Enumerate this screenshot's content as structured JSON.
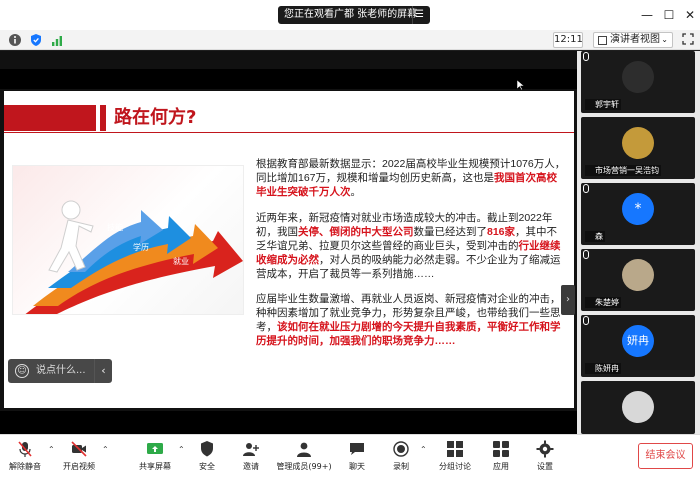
{
  "titlebar": {
    "share_notice": "您正在观看广都 张老师的屏幕",
    "minimize": "—",
    "maximize": "☐",
    "close": "✕"
  },
  "inforow": {
    "timer": "12:11",
    "view_label": "演讲者视图",
    "view_caret": "⌄"
  },
  "slide": {
    "title": "路在何方?",
    "image_words": [
      "技能",
      "学历",
      "就业"
    ],
    "p1_parts": [
      "根据教育部最新数据显示：2022届高校毕业生规模预计1076万人，同比增加167万，规模和增量均创历史新高，这也是",
      "我国首次高校毕业生突破千万人次",
      "。"
    ],
    "p2_parts": [
      "近两年来，新冠疫情对就业市场造成较大的冲击。截止到2022年初，我国",
      "关停、倒闭的中大型公司",
      "数量已经达到了",
      "816家",
      "，其中不乏华谊兄弟、拉夏贝尔这些曾经的商业巨头，受到冲击的",
      "行业继续收缩成为必然",
      "，对人员的吸纳能力必然走弱。不少企业为了缩减运营成本，开启了裁员等一系列措施……"
    ],
    "p3_parts": [
      "应届毕业生数量激增、再就业人员返岗、新冠疫情对企业的冲击，种种因素增加了就业竞争力，形势复杂且严峻，也带给我们一些思考，",
      "该如何在就业压力剧增的今天提升自我素质，平衡好工作和学历提升的时间，加强我们的职场竞争力……"
    ]
  },
  "chat": {
    "placeholder": "说点什么...",
    "collapse": "‹"
  },
  "panel_toggle": "›",
  "participants": [
    {
      "name": "郭宇轩",
      "avatar": "",
      "color": "#2d2d2d"
    },
    {
      "name": "市场营销一吴浩钧",
      "avatar": "",
      "color": "#c49a3a"
    },
    {
      "name": "森",
      "avatar": "*",
      "color": "#1677ff"
    },
    {
      "name": "朱楚婷",
      "avatar": "",
      "color": "#b9a88a"
    },
    {
      "name": "陈妍冉",
      "avatar": "妍冉",
      "color": "#1677ff"
    },
    {
      "name": "",
      "avatar": "",
      "color": "#d8d8d8"
    }
  ],
  "toolbar": {
    "unmute": "解除静音",
    "start_video": "开启视频",
    "share_screen": "共享屏幕",
    "security": "安全",
    "invite": "邀请",
    "manage_members": "管理成员(99+)",
    "chat": "聊天",
    "record": "录制",
    "breakout": "分组讨论",
    "apps": "应用",
    "settings": "设置",
    "end_meeting": "结束会议"
  },
  "colors": {
    "accent_red": "#c0161d",
    "end_red": "#e04848",
    "zoom_blue": "#1677ff"
  }
}
